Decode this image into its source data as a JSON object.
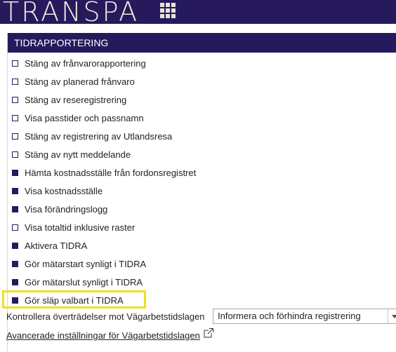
{
  "app": {
    "logo_text": "TRANSPA",
    "apps_icon": "grid-apps-icon"
  },
  "panel": {
    "title": "TIDRAPPORTERING",
    "items": [
      {
        "label": "Stäng av frånvarorapportering",
        "checked": false
      },
      {
        "label": "Stäng av planerad frånvaro",
        "checked": false
      },
      {
        "label": "Stäng av reseregistrering",
        "checked": false
      },
      {
        "label": "Visa passtider och passnamn",
        "checked": false
      },
      {
        "label": "Stäng av registrering av Utlandsresa",
        "checked": false
      },
      {
        "label": "Stäng av nytt meddelande",
        "checked": false
      },
      {
        "label": "Hämta kostnadsställe från fordonsregistret",
        "checked": true
      },
      {
        "label": "Visa kostnadsställe",
        "checked": true
      },
      {
        "label": "Visa förändringslogg",
        "checked": true
      },
      {
        "label": "Visa totaltid inklusive raster",
        "checked": false
      },
      {
        "label": "Aktivera TIDRA",
        "checked": true
      },
      {
        "label": "Gör mätarstart synligt i TIDRA",
        "checked": true
      },
      {
        "label": "Gör mätarslut synligt i TIDRA",
        "checked": true
      },
      {
        "label": "Gör släp valbart i TIDRA",
        "checked": true
      }
    ],
    "kontroll_label": "Kontrollera överträdelser mot Vägarbetstidslagen",
    "kontroll_select_value": "Informera och förhindra registrering",
    "advanced_link": "Avancerade inställningar för Vägarbetstidslagen"
  },
  "colors": {
    "brand": "#261a5c",
    "highlight": "#f0e11c"
  }
}
